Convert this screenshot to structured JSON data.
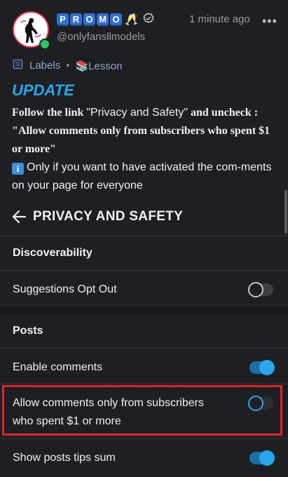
{
  "header": {
    "promo_letters": [
      "P",
      "R",
      "O",
      "M",
      "O"
    ],
    "handle": "@onlyfansllmodels",
    "time": "1 minute ago",
    "more": "•••"
  },
  "labels_row": {
    "labels": "Labels",
    "separator": "•",
    "lesson": "📚Lesson"
  },
  "post": {
    "update": "UPDATE",
    "line1_a": "Follow the link ",
    "line1_b": "\"Privacy and Safety\"",
    "line1_c": " and uncheck :",
    "line2": "\"Allow comments only from subscribers who spent $1 or more\"",
    "info_icon": "i",
    "line3": "Only if you want to have activated the com-ments on your page for everyone"
  },
  "settings": {
    "title": "PRIVACY AND SAFETY",
    "discoverability": "Discoverability",
    "suggestions_opt_out": "Suggestions Opt Out",
    "posts": "Posts",
    "enable_comments": "Enable comments",
    "allow_comments_line1": "Allow comments only from subscribers",
    "allow_comments_line2": "who spent $1 or more",
    "show_tips_sum": "Show posts tips sum"
  },
  "toggles": {
    "suggestions_opt_out": false,
    "enable_comments": true,
    "allow_comments_paid_only": false,
    "show_tips_sum": true
  },
  "colors": {
    "accent": "#2aa5ee",
    "highlight_border": "#e0242b",
    "update_text": "#2aa7e6"
  }
}
